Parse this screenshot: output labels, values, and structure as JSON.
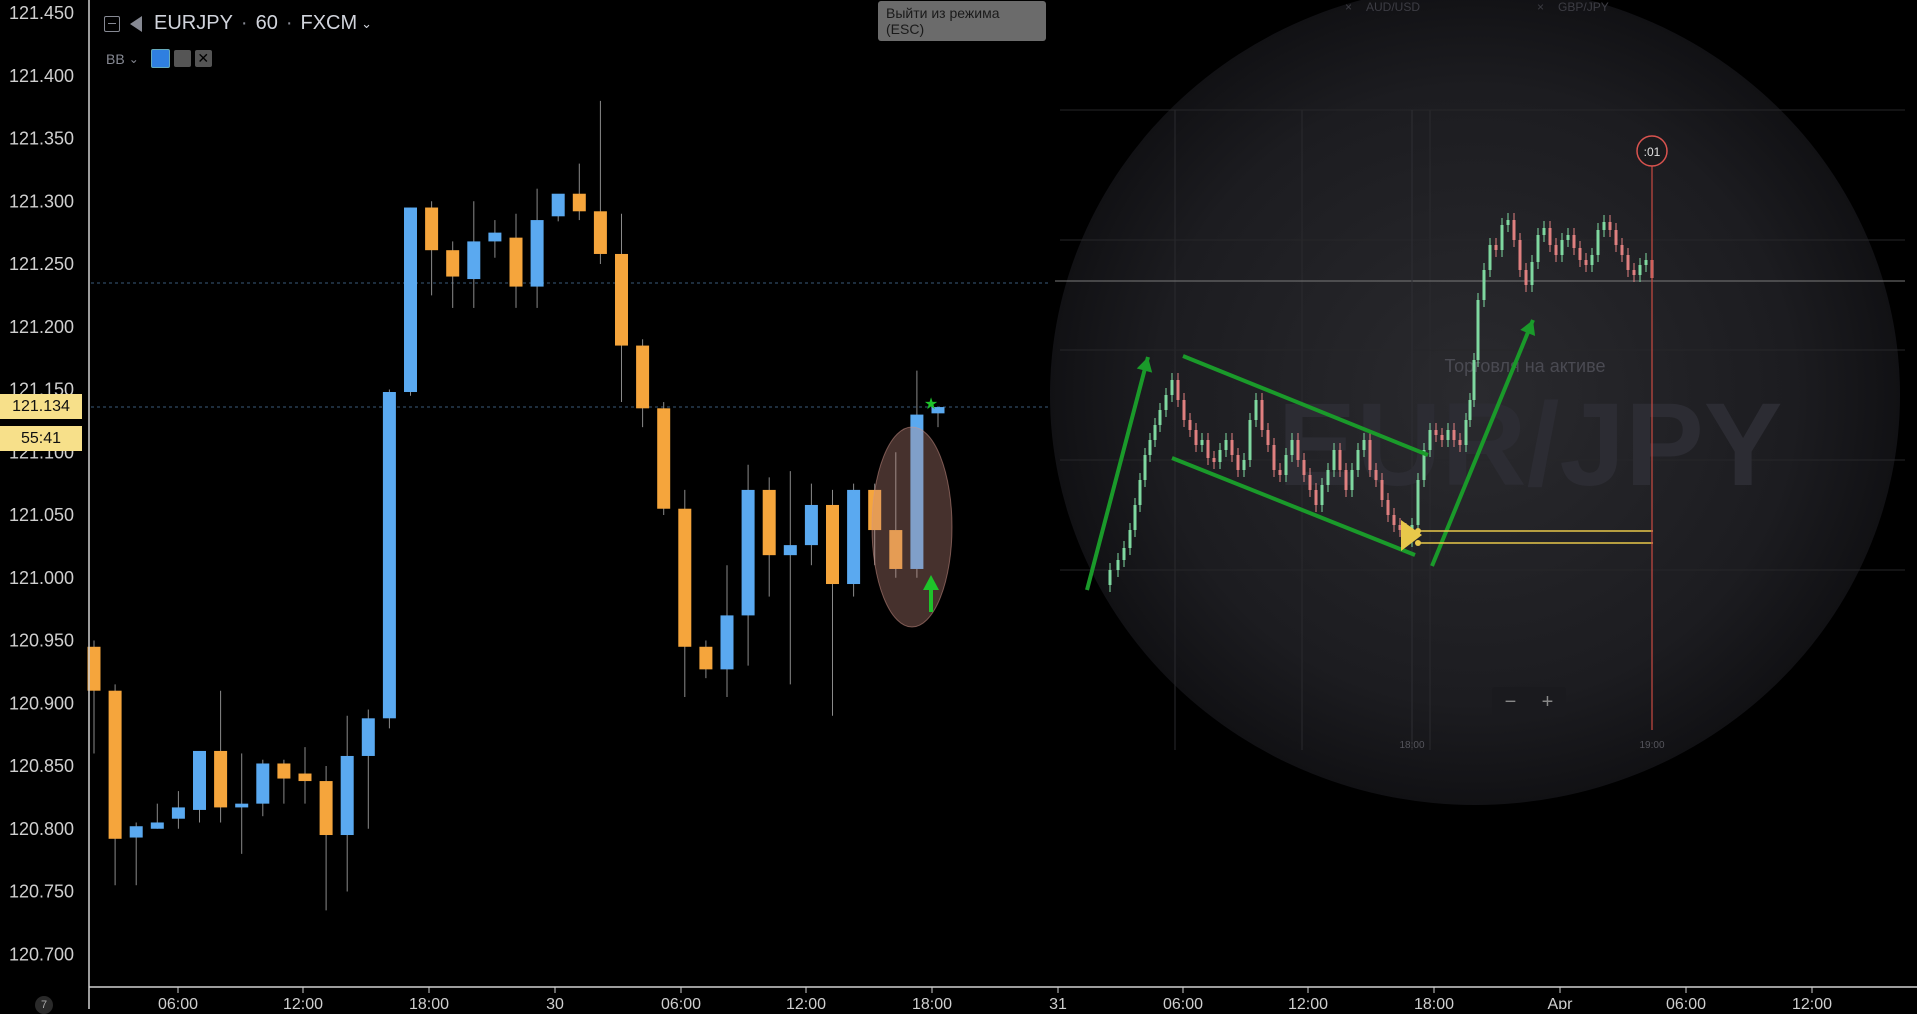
{
  "header": {
    "symbol": "EURJPY",
    "interval": "60",
    "exchange": "FXCM",
    "indicator": "BB"
  },
  "tooltip": {
    "text_line1": "Выйти из режима",
    "text_line2": "(ESC)"
  },
  "price_tag": {
    "price": "121.134",
    "countdown": "55:41"
  },
  "overlay": {
    "tab_left": "AUD/USD",
    "tab_right": "GBP/JPY",
    "watermark": "EUR/JPY",
    "caption": "Торговля на активе",
    "timer": ":01",
    "time_left": "18:00",
    "time_right": "19:00",
    "zoom_minus": "−",
    "zoom_plus": "+"
  },
  "page_indicator": "7",
  "colors": {
    "up": "#5aa9f0",
    "down": "#f5a53c",
    "background": "#000000",
    "axis_text": "#cfcfcf",
    "price_tag": "#f7e08a",
    "trend_arrows": "#1a9a2a",
    "mini_up": "#7fd8a0",
    "mini_down": "#e08080"
  },
  "chart_data": {
    "type": "candlestick",
    "symbol": "EURJPY",
    "interval": "60",
    "ylim": [
      120.67,
      121.47
    ],
    "y_ticks": [
      "121.450",
      "121.400",
      "121.350",
      "121.300",
      "121.250",
      "121.200",
      "121.150",
      "121.100",
      "121.050",
      "121.000",
      "120.950",
      "120.900",
      "120.850",
      "120.800",
      "120.750",
      "120.700"
    ],
    "x_ticks": [
      "06:00",
      "12:00",
      "18:00",
      "30",
      "06:00",
      "12:00",
      "18:00",
      "31",
      "06:00",
      "12:00",
      "18:00",
      "Apr",
      "06:00",
      "12:00"
    ],
    "last_price": 121.134,
    "candles": [
      {
        "o": 120.945,
        "h": 120.95,
        "c": 120.91,
        "l": 120.86,
        "dir": "down"
      },
      {
        "o": 120.91,
        "h": 120.915,
        "c": 120.792,
        "l": 120.755,
        "dir": "down"
      },
      {
        "o": 120.793,
        "h": 120.805,
        "c": 120.802,
        "l": 120.755,
        "dir": "up"
      },
      {
        "o": 120.8,
        "h": 120.82,
        "c": 120.805,
        "l": 120.8,
        "dir": "up"
      },
      {
        "o": 120.808,
        "h": 120.83,
        "c": 120.817,
        "l": 120.8,
        "dir": "up"
      },
      {
        "o": 120.815,
        "h": 120.862,
        "c": 120.862,
        "l": 120.805,
        "dir": "up"
      },
      {
        "o": 120.862,
        "h": 120.91,
        "c": 120.817,
        "l": 120.805,
        "dir": "down"
      },
      {
        "o": 120.817,
        "h": 120.86,
        "c": 120.82,
        "l": 120.78,
        "dir": "up"
      },
      {
        "o": 120.82,
        "h": 120.855,
        "c": 120.852,
        "l": 120.81,
        "dir": "up"
      },
      {
        "o": 120.852,
        "h": 120.855,
        "c": 120.84,
        "l": 120.82,
        "dir": "down"
      },
      {
        "o": 120.844,
        "h": 120.865,
        "c": 120.838,
        "l": 120.82,
        "dir": "down"
      },
      {
        "o": 120.838,
        "h": 120.85,
        "c": 120.795,
        "l": 120.735,
        "dir": "down"
      },
      {
        "o": 120.795,
        "h": 120.89,
        "c": 120.858,
        "l": 120.75,
        "dir": "up"
      },
      {
        "o": 120.858,
        "h": 120.895,
        "c": 120.888,
        "l": 120.8,
        "dir": "up"
      },
      {
        "o": 120.888,
        "h": 121.15,
        "c": 121.148,
        "l": 120.88,
        "dir": "up"
      },
      {
        "o": 121.148,
        "h": 121.295,
        "c": 121.295,
        "l": 121.145,
        "dir": "up"
      },
      {
        "o": 121.295,
        "h": 121.3,
        "c": 121.261,
        "l": 121.225,
        "dir": "down"
      },
      {
        "o": 121.261,
        "h": 121.268,
        "c": 121.24,
        "l": 121.215,
        "dir": "down"
      },
      {
        "o": 121.238,
        "h": 121.3,
        "c": 121.268,
        "l": 121.215,
        "dir": "up"
      },
      {
        "o": 121.268,
        "h": 121.285,
        "c": 121.275,
        "l": 121.255,
        "dir": "up"
      },
      {
        "o": 121.271,
        "h": 121.29,
        "c": 121.232,
        "l": 121.215,
        "dir": "down"
      },
      {
        "o": 121.232,
        "h": 121.31,
        "c": 121.285,
        "l": 121.215,
        "dir": "up"
      },
      {
        "o": 121.288,
        "h": 121.305,
        "c": 121.306,
        "l": 121.284,
        "dir": "up"
      },
      {
        "o": 121.306,
        "h": 121.33,
        "c": 121.292,
        "l": 121.285,
        "dir": "down"
      },
      {
        "o": 121.292,
        "h": 121.38,
        "c": 121.258,
        "l": 121.25,
        "dir": "down"
      },
      {
        "o": 121.258,
        "h": 121.29,
        "c": 121.185,
        "l": 121.14,
        "dir": "down"
      },
      {
        "o": 121.185,
        "h": 121.19,
        "c": 121.135,
        "l": 121.12,
        "dir": "down"
      },
      {
        "o": 121.135,
        "h": 121.14,
        "c": 121.055,
        "l": 121.05,
        "dir": "down"
      },
      {
        "o": 121.055,
        "h": 121.07,
        "c": 120.945,
        "l": 120.905,
        "dir": "down"
      },
      {
        "o": 120.945,
        "h": 120.95,
        "c": 120.927,
        "l": 120.92,
        "dir": "down"
      },
      {
        "o": 120.927,
        "h": 121.01,
        "c": 120.97,
        "l": 120.905,
        "dir": "up"
      },
      {
        "o": 120.97,
        "h": 121.09,
        "c": 121.07,
        "l": 120.93,
        "dir": "up"
      },
      {
        "o": 121.07,
        "h": 121.08,
        "c": 121.018,
        "l": 120.985,
        "dir": "down"
      },
      {
        "o": 121.018,
        "h": 121.085,
        "c": 121.026,
        "l": 120.915,
        "dir": "up"
      },
      {
        "o": 121.026,
        "h": 121.075,
        "c": 121.058,
        "l": 121.01,
        "dir": "up"
      },
      {
        "o": 121.058,
        "h": 121.07,
        "c": 120.995,
        "l": 120.89,
        "dir": "down"
      },
      {
        "o": 120.995,
        "h": 121.075,
        "c": 121.07,
        "l": 120.985,
        "dir": "up"
      },
      {
        "o": 121.07,
        "h": 121.075,
        "c": 121.038,
        "l": 121.01,
        "dir": "down"
      },
      {
        "o": 121.038,
        "h": 121.1,
        "c": 121.007,
        "l": 121.0,
        "dir": "down"
      },
      {
        "o": 121.007,
        "h": 121.165,
        "c": 121.13,
        "l": 121.0,
        "dir": "up"
      },
      {
        "o": 121.131,
        "h": 121.135,
        "c": 121.136,
        "l": 121.12,
        "dir": "up"
      }
    ]
  }
}
